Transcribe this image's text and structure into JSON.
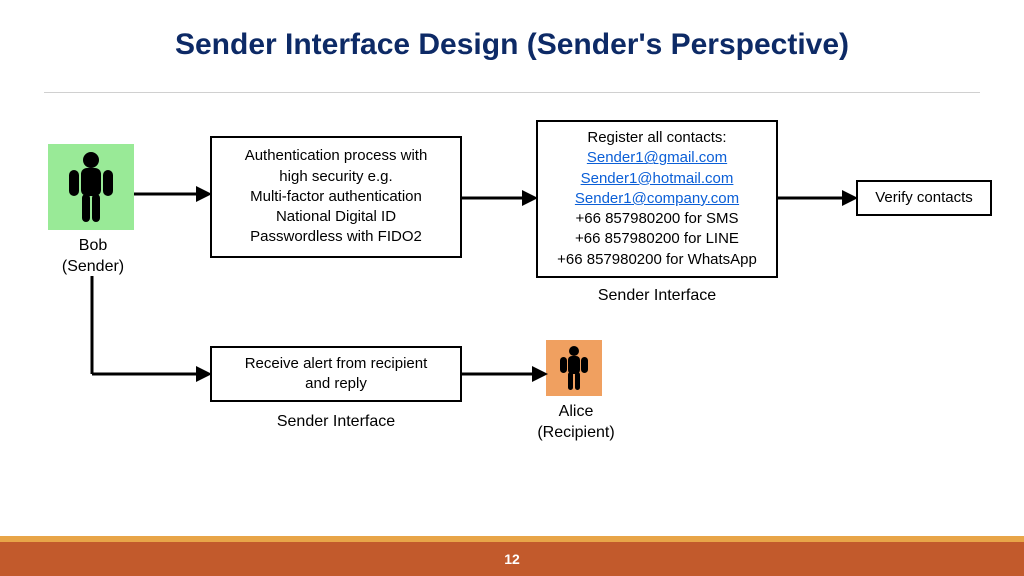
{
  "title": "Sender Interface Design (Sender's Perspective)",
  "page_number": "12",
  "actors": {
    "bob": {
      "name": "Bob",
      "role": "(Sender)"
    },
    "alice": {
      "name": "Alice",
      "role": "(Recipient)"
    }
  },
  "auth_box": {
    "lines": [
      "Authentication process with",
      "high security e.g.",
      "Multi-factor authentication",
      "National Digital ID",
      "Passwordless with FIDO2"
    ]
  },
  "register_box": {
    "header": "Register all contacts:",
    "emails": [
      "Sender1@gmail.com",
      "Sender1@hotmail.com",
      "Sender1@company.com"
    ],
    "phones": [
      "+66 857980200 for SMS",
      "+66 857980200 for LINE",
      "+66 857980200 for WhatsApp"
    ]
  },
  "verify_box": {
    "label": "Verify contacts"
  },
  "reply_box": {
    "lines": [
      "Receive alert from recipient",
      "and reply"
    ]
  },
  "captions": {
    "sender_interface_top": "Sender Interface",
    "sender_interface_bottom": "Sender Interface"
  }
}
